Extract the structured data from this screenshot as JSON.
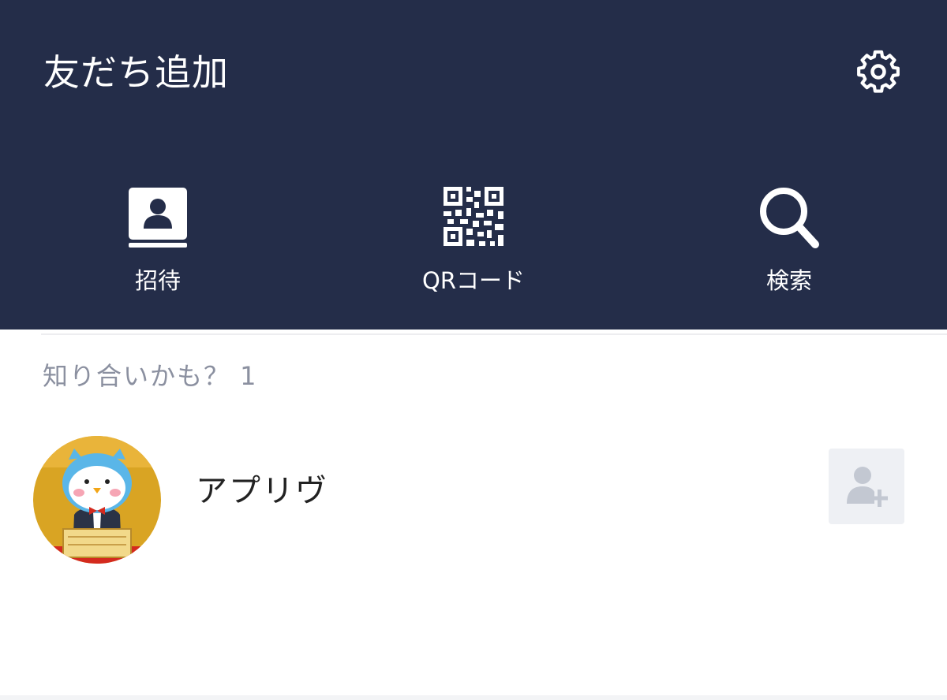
{
  "header": {
    "title": "友だち追加",
    "settings_icon": "gear-icon",
    "background": "#242d49"
  },
  "actions": [
    {
      "label": "招待",
      "icon": "contact-book-icon"
    },
    {
      "label": "QRコード",
      "icon": "qr-code-icon"
    },
    {
      "label": "検索",
      "icon": "search-icon"
    }
  ],
  "suggestions": {
    "title": "知り合いかも？ 1",
    "items": [
      {
        "name": "アプリヴ",
        "avatar": "penguin-mascot-avatar",
        "action_icon": "add-friend-icon"
      }
    ]
  }
}
